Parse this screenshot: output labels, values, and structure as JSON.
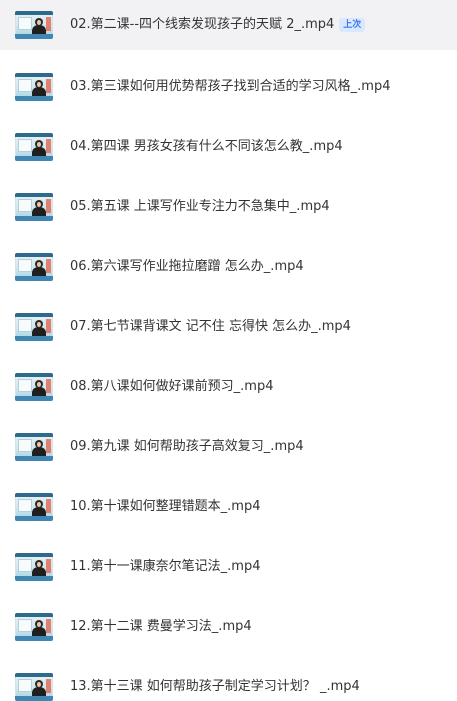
{
  "files": [
    {
      "title": "02.第二课--四个线索发现孩子的天赋 2_.mp4",
      "badge": "上次",
      "active": true
    },
    {
      "title": "03.第三课如何用优势帮孩子找到合适的学习风格_.mp4"
    },
    {
      "title": "04.第四课 男孩女孩有什么不同该怎么教_.mp4"
    },
    {
      "title": "05.第五课 上课写作业专注力不急集中_.mp4"
    },
    {
      "title": "06.第六课写作业拖拉磨蹭 怎么办_.mp4"
    },
    {
      "title": "07.第七节课背课文 记不住 忘得快 怎么办_.mp4"
    },
    {
      "title": "08.第八课如何做好课前预习_.mp4"
    },
    {
      "title": "09.第九课 如何帮助孩子高效复习_.mp4"
    },
    {
      "title": "10.第十课如何整理错题本_.mp4"
    },
    {
      "title": "11.第十一课康奈尔笔记法_.mp4"
    },
    {
      "title": "12.第十二课 费曼学习法_.mp4"
    },
    {
      "title": "13.第十三课 如何帮助孩子制定学习计划？ _.mp4"
    }
  ],
  "thumbnail_icon": "video-thumbnail",
  "colors": {
    "active_row_bg": "#f2f2f4",
    "badge_bg": "#d9e7ff",
    "badge_text": "#3a7af0",
    "text": "#333333"
  }
}
